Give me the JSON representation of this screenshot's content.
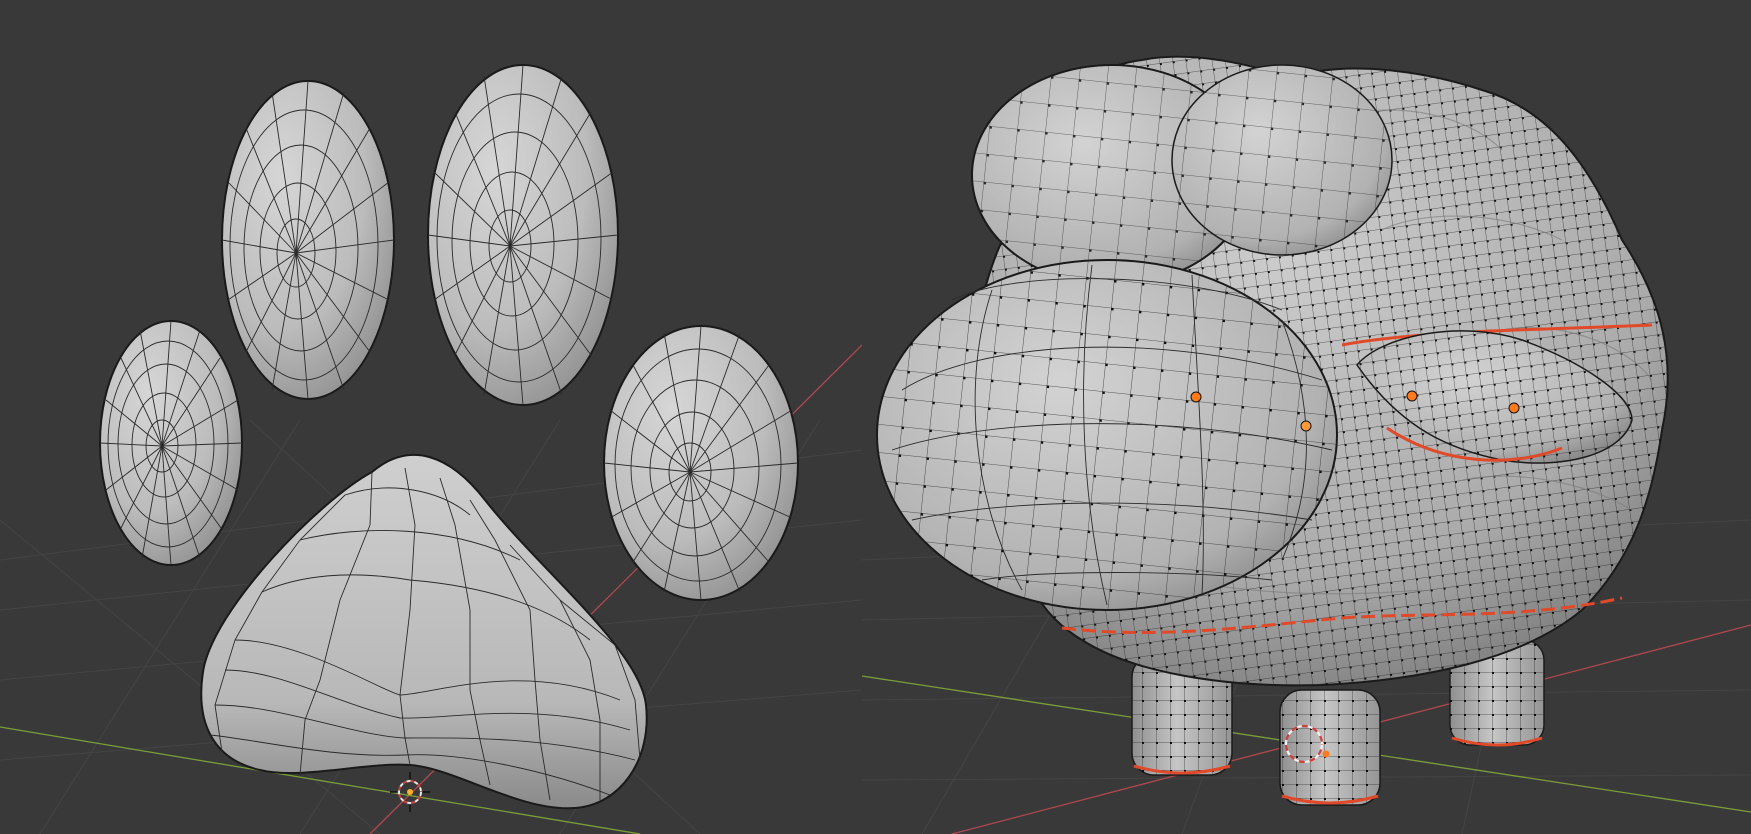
{
  "app": "blender-3d-viewport",
  "colors": {
    "background": "#393939",
    "grid_line": "#434343",
    "axis_x": "#b0484f",
    "axis_y": "#7d9d3a",
    "mesh_fill": "#bdbdbd",
    "mesh_wire": "#1a1a1a",
    "selected_edge": "#e04a2a",
    "selected_vertex": "#ff7a1a",
    "origin_cursor": "#e8e8e8"
  },
  "viewports": [
    {
      "id": "left",
      "object": "paw-print-mesh",
      "parts": [
        "toe-pad-1",
        "toe-pad-2",
        "toe-pad-3",
        "toe-pad-4",
        "main-pad"
      ],
      "show_vertices": false,
      "edit_mode": false
    },
    {
      "id": "right",
      "object": "sheep-mesh",
      "parts": [
        "body",
        "head",
        "ear-left",
        "ear-right",
        "leg-front-left",
        "leg-front-right",
        "leg-back"
      ],
      "show_vertices": true,
      "edit_mode": true
    }
  ],
  "icons": {
    "3d-cursor": "3d-cursor-icon"
  }
}
